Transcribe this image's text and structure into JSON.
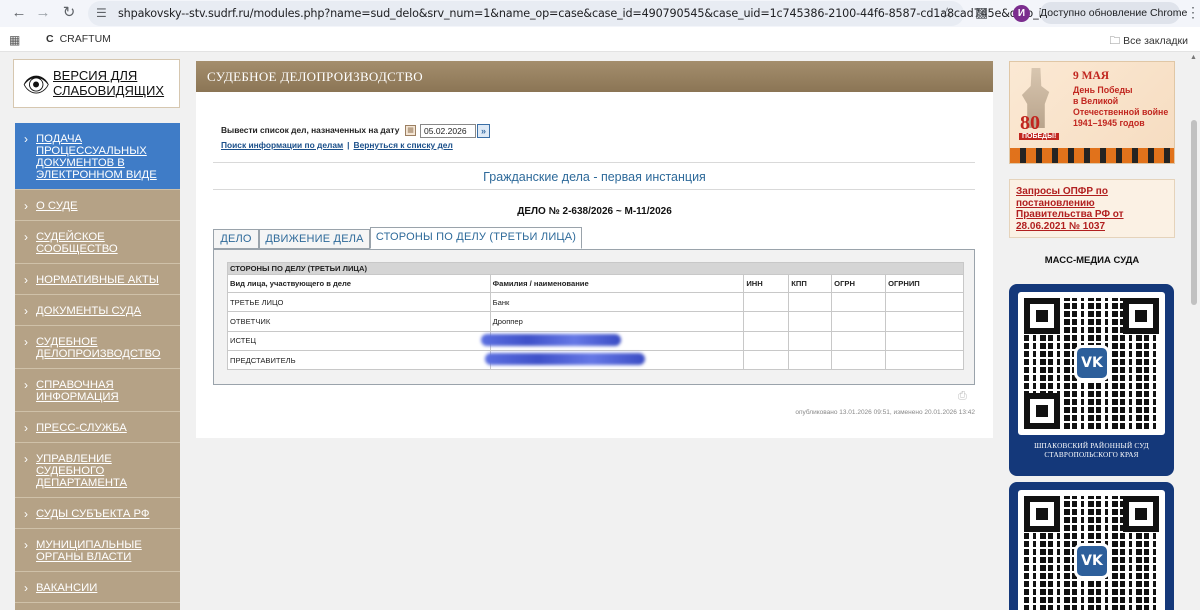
{
  "browser": {
    "url": "shpakovsky--stv.sudrf.ru/modules.php?name=sud_delo&srv_num=1&name_op=case&case_id=490790545&case_uid=1c745386-2100-44f6-8587-cd1a8cad745e&delo_id=15...",
    "profile_initial": "И",
    "update_label": "Доступно обновление Chrome",
    "bookmark_label": "CRAFTUM",
    "all_bookmarks_label": "Все закладки",
    "icons": [
      "back-arrow-icon",
      "forward-arrow-icon",
      "reload-icon",
      "site-info-icon",
      "star-icon",
      "extensions-icon",
      "menu-dots-icon",
      "apps-icon",
      "folder-icon"
    ]
  },
  "vision_version": {
    "label_line1": "ВЕРСИЯ ДЛЯ",
    "label_line2": "СЛАБОВИДЯЩИХ"
  },
  "sidebar": {
    "items": [
      {
        "lines": [
          "ПОДАЧА",
          "ПРОЦЕССУАЛЬНЫХ",
          "ДОКУМЕНТОВ В",
          "ЭЛЕКТРОННОМ ВИДЕ"
        ],
        "active": true
      },
      {
        "lines": [
          "О СУДЕ"
        ]
      },
      {
        "lines": [
          "СУДЕЙСКОЕ",
          "СООБЩЕСТВО"
        ]
      },
      {
        "lines": [
          "НОРМАТИВНЫЕ АКТЫ"
        ]
      },
      {
        "lines": [
          "ДОКУМЕНТЫ СУДА"
        ]
      },
      {
        "lines": [
          "СУДЕБНОЕ",
          "ДЕЛОПРОИЗВОДСТВО"
        ]
      },
      {
        "lines": [
          "СПРАВОЧНАЯ",
          "ИНФОРМАЦИЯ"
        ]
      },
      {
        "lines": [
          "ПРЕСС-СЛУЖБА"
        ]
      },
      {
        "lines": [
          "УПРАВЛЕНИЕ",
          "СУДЕБНОГО",
          "ДЕПАРТАМЕНТА"
        ]
      },
      {
        "lines": [
          "СУДЫ СУБЪЕКТА РФ"
        ]
      },
      {
        "lines": [
          "МУНИЦИПАЛЬНЫЕ",
          "ОРГАНЫ ВЛАСТИ"
        ]
      },
      {
        "lines": [
          "ВАКАНСИИ"
        ]
      }
    ]
  },
  "main": {
    "header": "СУДЕБНОЕ ДЕЛОПРОИЗВОДСТВО",
    "date_label": "Вывести список дел, назначенных на дату",
    "date_value": "05.02.2026",
    "link_search": "Поиск информации по делам",
    "link_separator": "|",
    "link_back": "Вернуться к списку дел",
    "section_title": "Гражданские дела - первая инстанция",
    "case_number": "ДЕЛО № 2-638/2026 ~ М-11/2026",
    "tabs": [
      {
        "label": "ДЕЛО"
      },
      {
        "label": "ДВИЖЕНИЕ ДЕЛА"
      },
      {
        "label": "СТОРОНЫ ПО ДЕЛУ (ТРЕТЬИ ЛИЦА)",
        "active": true
      }
    ],
    "table": {
      "caption": "СТОРОНЫ ПО ДЕЛУ (ТРЕТЬИ ЛИЦА)",
      "columns": [
        "Вид лица, участвующего в деле",
        "Фамилия / наименование",
        "ИНН",
        "КПП",
        "ОГРН",
        "ОГРНИП"
      ],
      "rows": [
        {
          "role": "ТРЕТЬЕ ЛИЦО",
          "name": "Банк",
          "redacted": false
        },
        {
          "role": "ОТВЕТЧИК",
          "name": "Дроппер",
          "redacted": false
        },
        {
          "role": "ИСТЕЦ",
          "name": "",
          "redacted": true
        },
        {
          "role": "ПРЕДСТАВИТЕЛЬ",
          "name": "",
          "redacted": true
        }
      ]
    },
    "publication_info": "опубликовано 13.01.2026 09:51, изменено 20.01.2026 13:42"
  },
  "right_sidebar": {
    "may9_banner": {
      "title": "9 МАЯ",
      "lines": [
        "День Победы",
        "в Великой",
        "Отечественной войне",
        "1941–1945 годов"
      ],
      "number": "80",
      "ribbon_text": "ПОБЕДЫ!"
    },
    "opfr_link": "Запросы ОПФР по постановлению Правительства РФ от 28.06.2021 № 1037",
    "mass_media_label": "МАСС-МЕДИА СУДА",
    "qr_caption_line1": "ШПАКОВСКИЙ РАЙОННЫЙ СУД",
    "qr_caption_line2": "СТАВРОПОЛЬСКОГО КРАЯ",
    "vk_logo_text": "VK"
  },
  "colors": {
    "accent_brown": "#a48e6d",
    "sidebar_bg": "#b5a286",
    "active_item": "#3f7cc7",
    "link_blue": "#1a4f8a",
    "title_blue": "#2e6a9a",
    "qr_card_bg": "#14387a",
    "banner_red": "#c1261f"
  }
}
